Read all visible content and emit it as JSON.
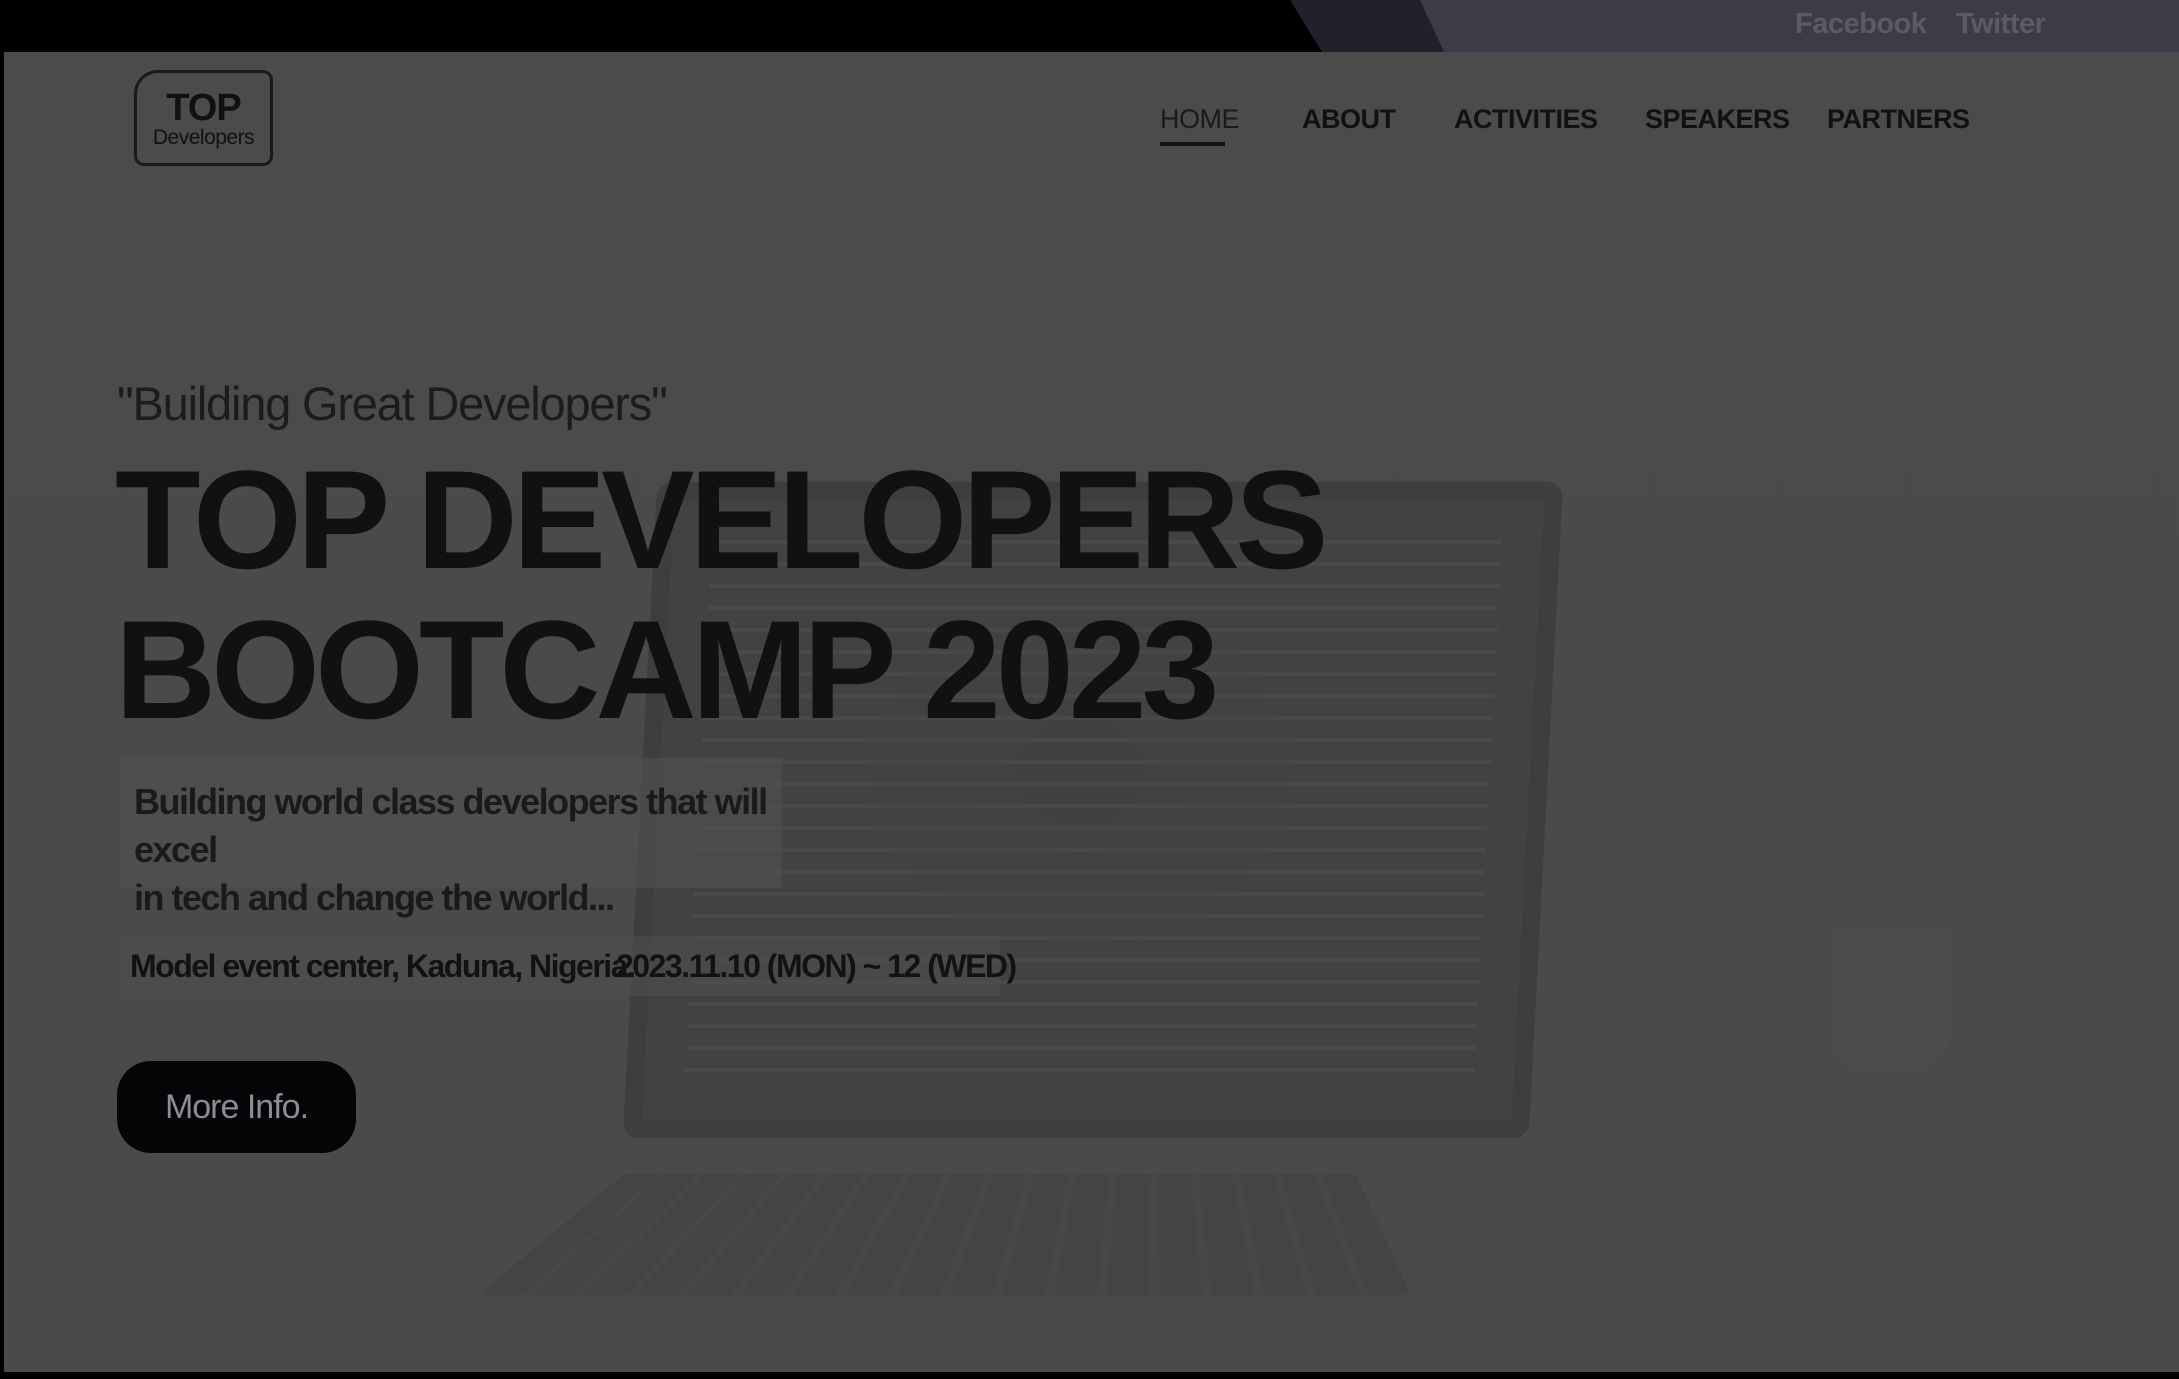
{
  "topbar": {
    "social": [
      "Facebook",
      "Twitter"
    ]
  },
  "logo": {
    "title": "TOP",
    "subtitle": "Developers"
  },
  "nav": {
    "items": [
      "HOME",
      "ABOUT",
      "ACTIVITIES",
      "SPEAKERS",
      "PARTNERS"
    ],
    "active": "HOME"
  },
  "hero": {
    "tagline": "\"Building Great Developers\"",
    "headline_line1": "TOP DEVELOPERS",
    "headline_line2": "BOOTCAMP 2023",
    "description_line1": "Building world class developers that will excel",
    "description_line2": "in tech and change the world...",
    "location": "Model event center, Kaduna, Nigeria.",
    "dates": "2023.11.10 (MON) ~ 12 (WED)",
    "button_label": "More Info."
  },
  "colors": {
    "overlay": "#4a4a4a",
    "topbar": "#000000",
    "text_dark": "#111113",
    "button_bg": "#050507"
  }
}
